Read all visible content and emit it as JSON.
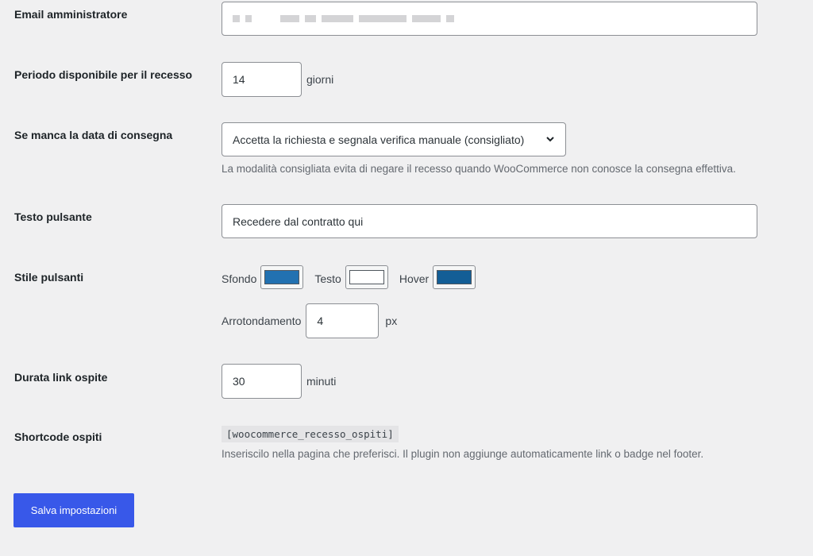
{
  "fields": {
    "email": {
      "label": "Email amministratore"
    },
    "period": {
      "label": "Periodo disponibile per il recesso",
      "value": "14",
      "suffix": "giorni"
    },
    "delivery": {
      "label": "Se manca la data di consegna",
      "selected": "Accetta la richiesta e segnala verifica manuale (consigliato)",
      "description": "La modalità consigliata evita di negare il recesso quando WooCommerce non conosce la consegna effettiva."
    },
    "button_text": {
      "label": "Testo pulsante",
      "value": "Recedere dal contratto qui"
    },
    "button_style": {
      "label": "Stile pulsanti",
      "background_label": "Sfondo",
      "background_color": "#2271b1",
      "text_label": "Testo",
      "text_color": "#ffffff",
      "hover_label": "Hover",
      "hover_color": "#135e96",
      "radius_label": "Arrotondamento",
      "radius_value": "4",
      "radius_suffix": "px"
    },
    "guest_link": {
      "label": "Durata link ospite",
      "value": "30",
      "suffix": "minuti"
    },
    "shortcode": {
      "label": "Shortcode ospiti",
      "code": "[woocommerce_recesso_ospiti]",
      "description": "Inseriscilo nella pagina che preferisci. Il plugin non aggiunge automaticamente link o badge nel footer."
    }
  },
  "save_label": "Salva impostazioni",
  "colors": {
    "accent": "#3858e9",
    "background": "#f0f0f1"
  }
}
